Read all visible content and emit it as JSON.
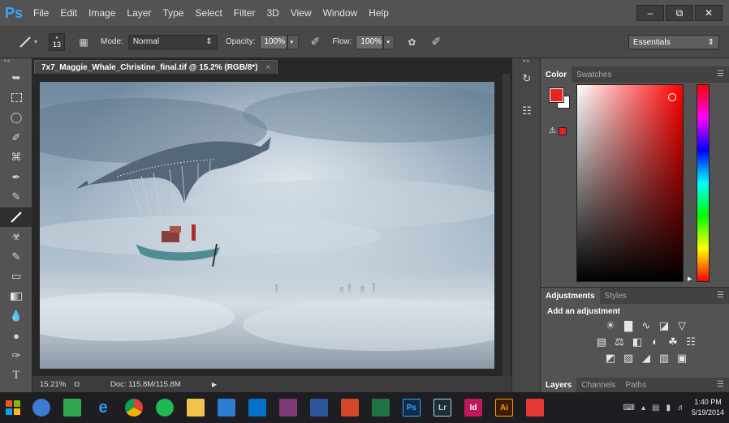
{
  "app": {
    "logo": "Ps",
    "menu": [
      "File",
      "Edit",
      "Image",
      "Layer",
      "Type",
      "Select",
      "Filter",
      "3D",
      "View",
      "Window",
      "Help"
    ]
  },
  "window_controls": {
    "minimize_icon": "minimize-icon",
    "restore_icon": "restore-icon",
    "close_icon": "close-icon"
  },
  "options": {
    "brush_size": "13",
    "mode_label": "Mode:",
    "mode_value": "Normal",
    "opacity_label": "Opacity:",
    "opacity_value": "100%",
    "flow_label": "Flow:",
    "flow_value": "100%",
    "workspace": "Essentials"
  },
  "tools": [
    "move-tool",
    "marquee-tool",
    "lasso-tool",
    "quick-selection-tool",
    "crop-tool",
    "eyedropper-tool",
    "healing-brush-tool",
    "brush-tool",
    "clone-stamp-tool",
    "history-brush-tool",
    "eraser-tool",
    "gradient-tool",
    "blur-tool",
    "dodge-tool",
    "pen-tool",
    "type-tool"
  ],
  "document": {
    "tab_title": "7x7_Maggie_Whale_Christine_final.tif @ 15.2% (RGB/8*)",
    "zoom": "15.21%",
    "doc_size": "Doc: 115.8M/115.8M"
  },
  "color_panel": {
    "tabs": [
      "Color",
      "Swatches"
    ],
    "foreground": "#e8241f",
    "background": "#ffffff"
  },
  "adjustments_panel": {
    "tabs": [
      "Adjustments",
      "Styles"
    ],
    "heading": "Add an adjustment",
    "rows": [
      [
        "brightness-contrast-icon",
        "levels-icon",
        "curves-icon",
        "exposure-icon",
        "vibrance-icon"
      ],
      [
        "hue-saturation-icon",
        "color-balance-icon",
        "black-white-icon",
        "photo-filter-icon",
        "channel-mixer-icon",
        "color-lookup-icon"
      ],
      [
        "invert-icon",
        "posterize-icon",
        "threshold-icon",
        "gradient-map-icon",
        "selective-color-icon"
      ]
    ]
  },
  "layers_panel": {
    "tabs": [
      "Layers",
      "Channels",
      "Paths"
    ]
  },
  "taskbar": {
    "apps": [
      {
        "name": "chrome-app",
        "label": "",
        "color": "#f4b400"
      },
      {
        "name": "ps-app",
        "label": "Ps",
        "color": "#0f2d4a"
      },
      {
        "name": "lr-app",
        "label": "Lr",
        "color": "#1c2f33"
      },
      {
        "name": "id-app",
        "label": "Id",
        "color": "#c2185b"
      },
      {
        "name": "ai-app",
        "label": "Ai",
        "color": "#3d1d00"
      }
    ],
    "time": "1:40 PM",
    "date": "5/19/2014"
  }
}
